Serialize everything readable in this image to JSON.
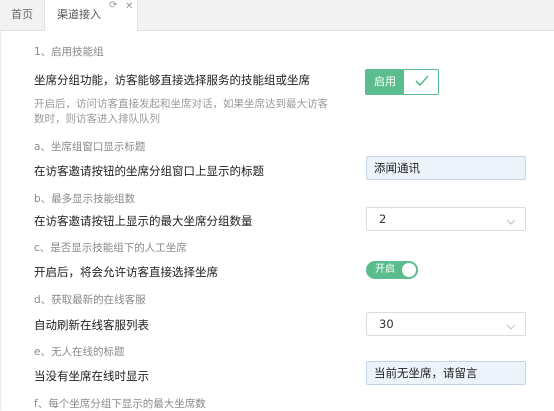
{
  "tabs": {
    "home": "首页",
    "active": "渠道接入"
  },
  "sections": {
    "s1": {
      "title": "1、启用技能组",
      "label": "坐席分组功能，访客能够直接选择服务的技能组或坐席",
      "enable_label": "启用",
      "desc": "开启后，访问访客直接发起和坐席对话，如果坐席达到最大访客数时，则访客进入排队队列"
    },
    "a": {
      "title": "a、坐席组窗口显示标题",
      "label": "在访客邀请按钮的坐席分组窗口上显示的标题",
      "value": "添闻通讯"
    },
    "b": {
      "title": "b、最多显示技能组数",
      "label": "在访客邀请按钮上显示的最大坐席分组数量",
      "value": "2"
    },
    "c": {
      "title": "c、是否显示技能组下的人工坐席",
      "label": "开启后，将会允许访客直接选择坐席",
      "switch_label": "开启"
    },
    "d": {
      "title": "d、获取最新的在线客服",
      "label": "自动刷新在线客服列表",
      "value": "30"
    },
    "e": {
      "title": "e、无人在线的标题",
      "label": "当没有坐席在线时显示",
      "value": "当前无坐席，请留言"
    },
    "f": {
      "title": "f、每个坐席分组下显示的最大坐席数"
    }
  }
}
